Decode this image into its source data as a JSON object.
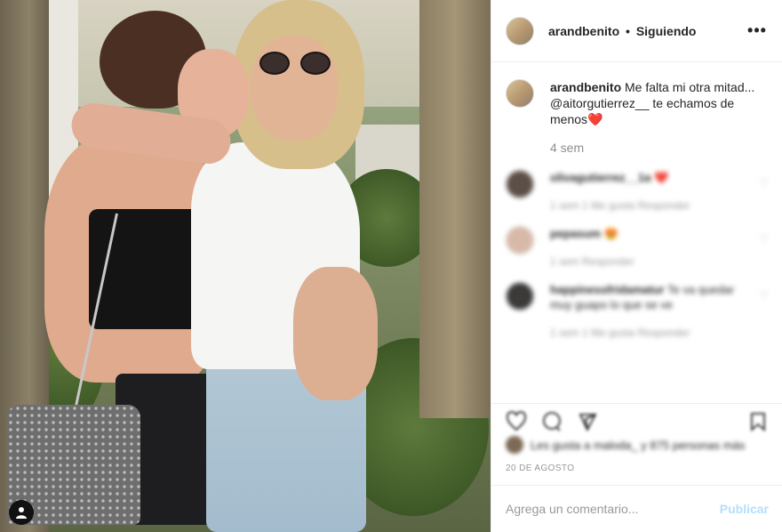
{
  "post": {
    "username": "arandbenito",
    "separator": "•",
    "follow_status": "Siguiendo",
    "more_icon": "more-horizontal-icon",
    "caption_user": "arandbenito",
    "caption_text": "Me falta mi otra mitad... @aitorgutierrez__ te echamos de menos",
    "caption_emoji": "❤️",
    "caption_time": "4 sem",
    "comments": [
      {
        "user": "olivagutierrez__1a",
        "text": "❤️",
        "meta": "1 sem  1 Me gusta  Responder"
      },
      {
        "user": "pepasum",
        "text": "😍",
        "meta": "1 sem  Responder"
      },
      {
        "user": "happinessfridamatur",
        "text": "Te va quedar muy guapo lo que se ve",
        "meta": "1 sem  1 Me gusta  Responder"
      }
    ],
    "likes_text": "Les gusta a maloda_ y 875 personas más",
    "date": "20 DE AGOSTO",
    "comment_placeholder": "Agrega un comentario...",
    "publish_label": "Publicar",
    "icons": [
      "heart-icon",
      "comment-icon",
      "share-icon",
      "bookmark-icon"
    ]
  }
}
